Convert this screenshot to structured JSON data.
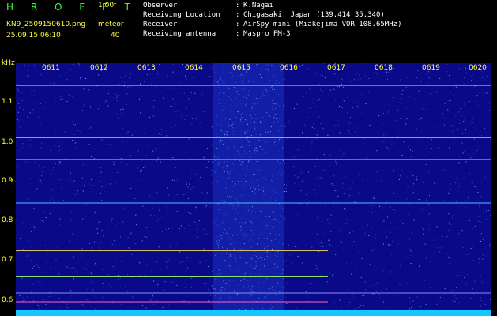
{
  "header": {
    "app_title": "H R O F F T",
    "version": "1.00f",
    "file_name": "KN9_2509150610.png",
    "mode": "meteor",
    "datetime": "25.09.15 06:10",
    "count": "40"
  },
  "info": [
    {
      "label": "Observer",
      "value": "K.Nagai"
    },
    {
      "label": "Receiving Location",
      "value": "Chigasaki, Japan (139.414 35.340)"
    },
    {
      "label": "Receiver",
      "value": "AirSpy mini (Miakejima VOR 108.65MHz)"
    },
    {
      "label": "Receiving antenna",
      "value": "Maspro FM-3"
    }
  ],
  "colon": ":",
  "axis": {
    "unit": "kHz",
    "freq_labels": [
      "1.1",
      "1.0",
      "0.9",
      "0.8",
      "0.7",
      "0.6"
    ],
    "time_labels": [
      "0611",
      "0612",
      "0613",
      "0614",
      "0615",
      "0616",
      "0617",
      "0618",
      "0619",
      "0620"
    ]
  },
  "colors": {
    "background": "#0a0a88",
    "text_yellow": "#ffff3c",
    "text_green": "#32ff32",
    "text_white": "#ffffff",
    "bottom_bar": "#14c8ff"
  }
}
